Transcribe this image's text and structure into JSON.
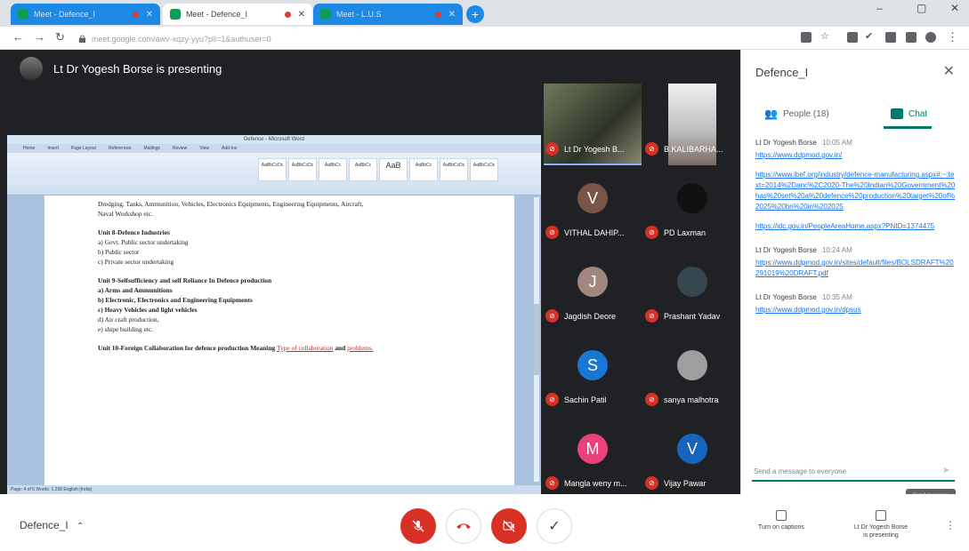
{
  "browser": {
    "tabs": [
      {
        "title": "Meet - Defence_I"
      },
      {
        "title": "Meet - Defence_I"
      },
      {
        "title": "Meet - L.U.S"
      }
    ],
    "new_tab": "+",
    "url": "meet.google.com/awv-xqzy-yyu?pli=1&authuser=0",
    "window_controls": [
      "–",
      "▢",
      "✕"
    ]
  },
  "stage": {
    "presenting_label": "Lt Dr Yogesh Borse is presenting"
  },
  "document": {
    "window_title": "Defence - Microsoft Word",
    "ribbon_tabs": [
      "Home",
      "Insert",
      "Page Layout",
      "References",
      "Mailings",
      "Review",
      "View",
      "Add-Ins"
    ],
    "styles": [
      "AaBbCcDc",
      "AaBbCcDc",
      "AaBbCc",
      "AaBbCc",
      "AaB",
      "AaBbCc",
      "AaBbCcDc",
      "AaBbCcDc"
    ],
    "lines": [
      {
        "text": "Dredging, Tanks, Ammunition, Vehicles, Electronics Equipments, Engineering Equipments, Aircraft,",
        "bold": false
      },
      {
        "text": "Naval Workshop etc.",
        "bold": false
      },
      {
        "text": "",
        "bold": false
      },
      {
        "text": "Unit 8-Defence Industries",
        "bold": true
      },
      {
        "text": "a) Govt. Public sector undertaking",
        "bold": false
      },
      {
        "text": "b) Public sector",
        "bold": false
      },
      {
        "text": "c) Private sector undertaking",
        "bold": false
      },
      {
        "text": "",
        "bold": false
      },
      {
        "text": "Unit 9-Selfsufficiency and self Reliance In Defence production",
        "bold": true
      },
      {
        "text": "a) Arms and Ammunitions",
        "bold": true
      },
      {
        "text": "b) Electronic, Electronics and Engineering Equipments",
        "bold": true
      },
      {
        "text": "c) Heavy Vehicles and light vehicles",
        "bold": true
      },
      {
        "text": "d) Air craft production,",
        "bold": false
      },
      {
        "text": "e) shipe building etc.",
        "bold": false
      },
      {
        "text": "",
        "bold": false
      }
    ],
    "last_line": {
      "bold": "Unit 10-Foreign Collaboration for defence production Meaning ",
      "red1": "Type of collaboration",
      "mid": " and ",
      "red2": "problems."
    },
    "status": "Page: 4 of 5   Words: 1,258   English (India)"
  },
  "participants": [
    {
      "name": "Lt Dr Yogesh B...",
      "type": "video"
    },
    {
      "name": "B.KALIBARHA...",
      "type": "video2"
    },
    {
      "name": "VITHAL DAHIP...",
      "initial": "V",
      "color": "#795548"
    },
    {
      "name": "PD Laxman",
      "initial": "",
      "color": "#111111"
    },
    {
      "name": "Jagdish Deore",
      "initial": "J",
      "color": "#a1887f"
    },
    {
      "name": "Prashant Yadav",
      "initial": "",
      "color": "#37474f"
    },
    {
      "name": "Sachin Patil",
      "initial": "S",
      "color": "#1976d2"
    },
    {
      "name": "sanya malhotra",
      "initial": "",
      "color": "#9e9e9e"
    },
    {
      "name": "Mangla weny m...",
      "initial": "M",
      "color": "#ec407a"
    },
    {
      "name": "Vijay Pawar",
      "initial": "V",
      "color": "#1565c0"
    }
  ],
  "side_panel": {
    "title": "Defence_I",
    "people_tab": "People (18)",
    "chat_tab": "Chat",
    "messages": [
      {
        "sender": "Lt Dr Yogesh Borse",
        "time": "10:05 AM",
        "links": [
          "https://www.ddpmod.gov.in/"
        ]
      },
      {
        "sender": "",
        "time": "",
        "links": [
          "https://www.ibef.org/industry/defence-manufacturing.aspx#:~:text=2014%2Danc%2C2020-The%20Indian%20Government%20has%20set%20a%20defence%20production%20target%20of%2025%20bn%20in%202025",
          "https://idc.gov.in/PeopleAreaHome.aspx?PNID=1374475"
        ]
      },
      {
        "sender": "Lt Dr Yogesh Borse",
        "time": "10:24 AM",
        "links": [
          "https://www.ddpmod.gov.in/sites/default/files/BOLSDRAFT%20291019%20DRAFT.pdf"
        ]
      },
      {
        "sender": "Lt Dr Yogesh Borse",
        "time": "10:35 AM",
        "links": [
          "https://www.ddpmod.gov.in/dpsus"
        ]
      }
    ],
    "compose_placeholder": "Send a message to everyone",
    "send_tooltip": "Send message"
  },
  "bottom_bar": {
    "meeting_name": "Defence_I",
    "mic_icon": "mic-off-icon",
    "hangup_icon": "call-end-icon",
    "cam_icon": "videocam-off-icon",
    "captions_label": "Turn on captions",
    "presenting_label_1": "Lt Dr Yogesh Borse",
    "presenting_label_2": "is presenting",
    "more": "⋮"
  }
}
